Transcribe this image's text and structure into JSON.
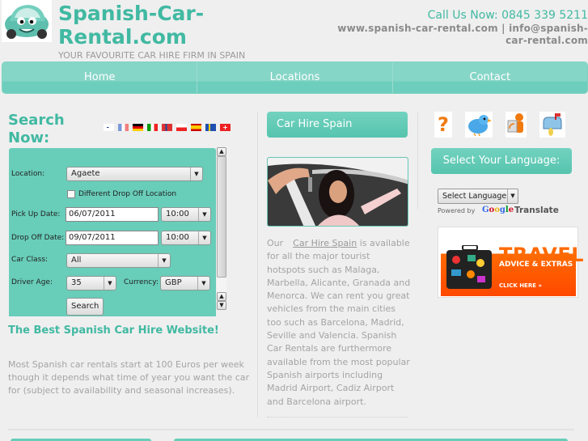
{
  "header": {
    "site_title": "Spanish-Car-Rental.com",
    "tagline": "YOUR FAVOURITE CAR HIRE FIRM IN SPAIN",
    "call_us": "Call Us Now: 0845 339 5211",
    "contact_line": "www.spanish-car-rental.com | info@spanish-car-rental.com",
    "logo_icon": "cartoon-car-icon"
  },
  "nav": {
    "items": [
      {
        "label": "Home"
      },
      {
        "label": "Locations"
      },
      {
        "label": "Contact"
      }
    ]
  },
  "search": {
    "title": "Search Now:",
    "flags": [
      "fi",
      "fr",
      "de",
      "it",
      "no",
      "pl",
      "es",
      "se",
      "ch"
    ],
    "location_label": "Location:",
    "location_value": "Agaete",
    "different_dropoff_label": "Different Drop Off Location",
    "different_dropoff_checked": false,
    "pickup_label": "Pick Up Date:",
    "pickup_date": "06/07/2011",
    "pickup_time": "10:00",
    "dropoff_label": "Drop Off Date:",
    "dropoff_date": "09/07/2011",
    "dropoff_time": "10:00",
    "car_class_label": "Car Class:",
    "car_class_value": "All",
    "driver_age_label": "Driver Age:",
    "driver_age_value": "35",
    "currency_label": "Currency:",
    "currency_value": "GBP",
    "search_button": "Search"
  },
  "left": {
    "best_title": "The Best Spanish Car Hire Website!",
    "best_text": "Most Spanish car rentals start at 100 Euros per week though it depends what time of year you want the car for (subject to availability and seasonal increases)."
  },
  "middle": {
    "button_label": "Car Hire Spain",
    "text_prefix": "Our",
    "text_link": "Car Hire Spain",
    "text_body": " is available for all the major tourist hotspots such as Malaga, Marbella, Alicante, Granada and Menorca. We can rent you great vehicles from the main cities too such as Barcelona, Madrid, Seville and Valencia. Spanish Car Rentals are furthermore available from the most popular Spanish airports including Madrid Airport, Cadiz Airport and Barcelona airport."
  },
  "right": {
    "icons": [
      "help-question-icon",
      "twitter-bird-icon",
      "rss-reader-icon",
      "mailbox-icon"
    ],
    "language_button": "Select Your Language:",
    "language_select": "Select Language",
    "powered_by": "Powered by",
    "google": "Google",
    "translate": "Translate",
    "travel_title": "TRAVEL",
    "travel_sub": "ADVICE & EXTRAS",
    "travel_click": "CLICK HERE »"
  },
  "colors": {
    "brand_teal": "#41b9a2",
    "nav_teal": "#86d6c7",
    "form_teal": "#68cdb9",
    "travel_orange": "#ff6a00"
  }
}
